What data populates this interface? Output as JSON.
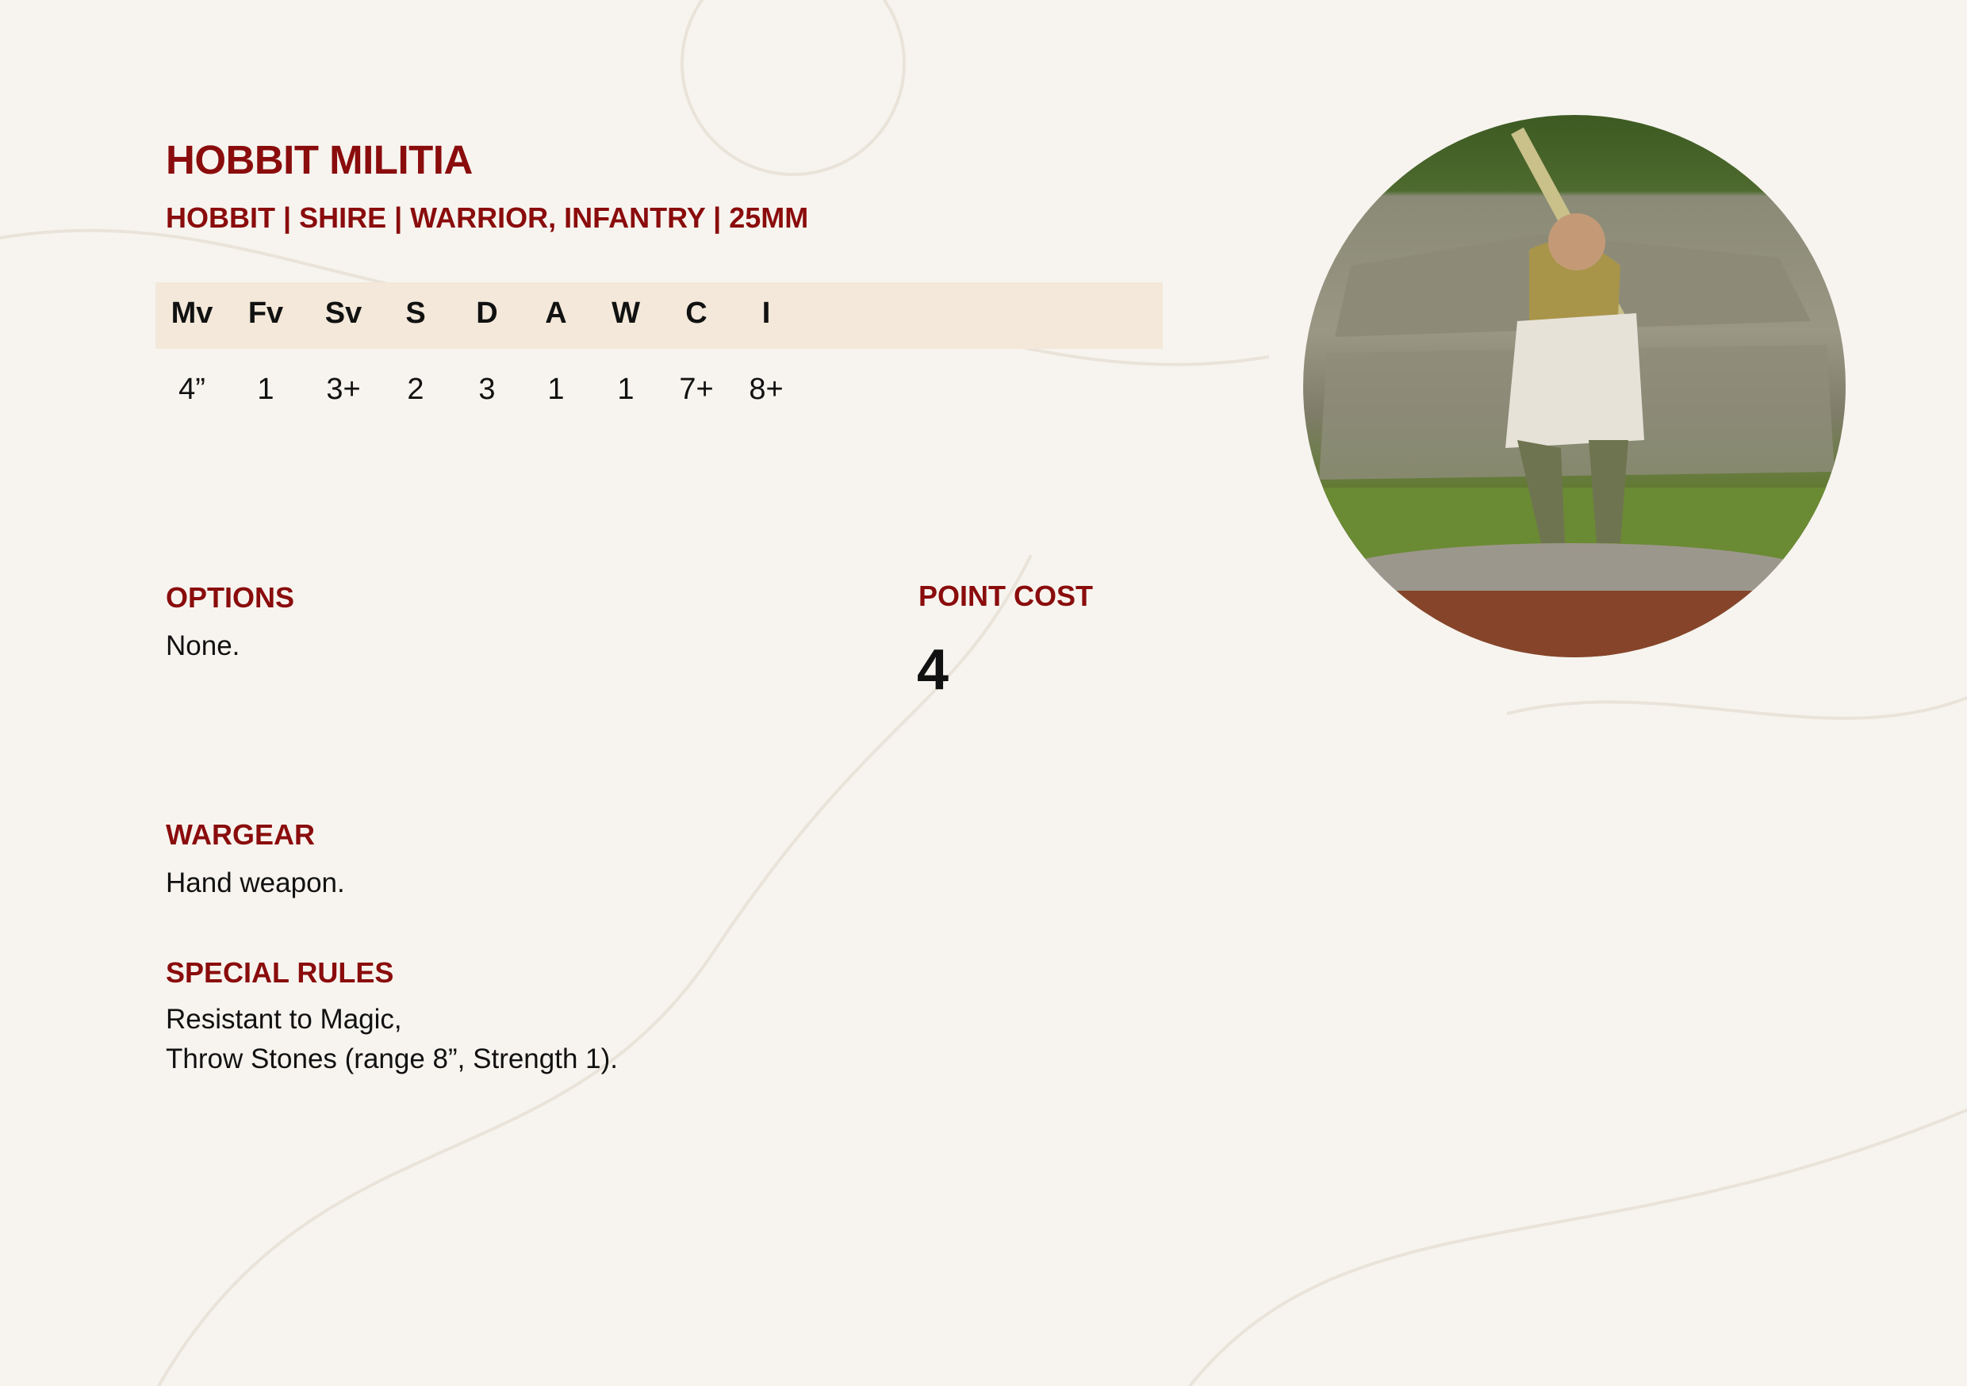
{
  "unit": {
    "name": "HOBBIT MILITIA",
    "keywords": "HOBBIT | SHIRE | WARRIOR, INFANTRY | 25MM"
  },
  "stats": {
    "headers": [
      "Mv",
      "Fv",
      "Sv",
      "S",
      "D",
      "A",
      "W",
      "C",
      "I"
    ],
    "values": [
      "4”",
      "1",
      "3+",
      "2",
      "3",
      "1",
      "1",
      "7+",
      "8+"
    ]
  },
  "options": {
    "heading": "OPTIONS",
    "text": "None."
  },
  "point_cost": {
    "heading": "POINT COST",
    "value": "4"
  },
  "wargear": {
    "heading": "WARGEAR",
    "text": "Hand weapon."
  },
  "special_rules": {
    "heading": "SPECIAL RULES",
    "lines": [
      "Resistant to Magic,",
      "Throw Stones (range 8”, Strength 1)."
    ]
  },
  "colors": {
    "accent": "#8a0c0c",
    "stat_bar": "#f3e8d9",
    "background": "#f7f4ef"
  }
}
